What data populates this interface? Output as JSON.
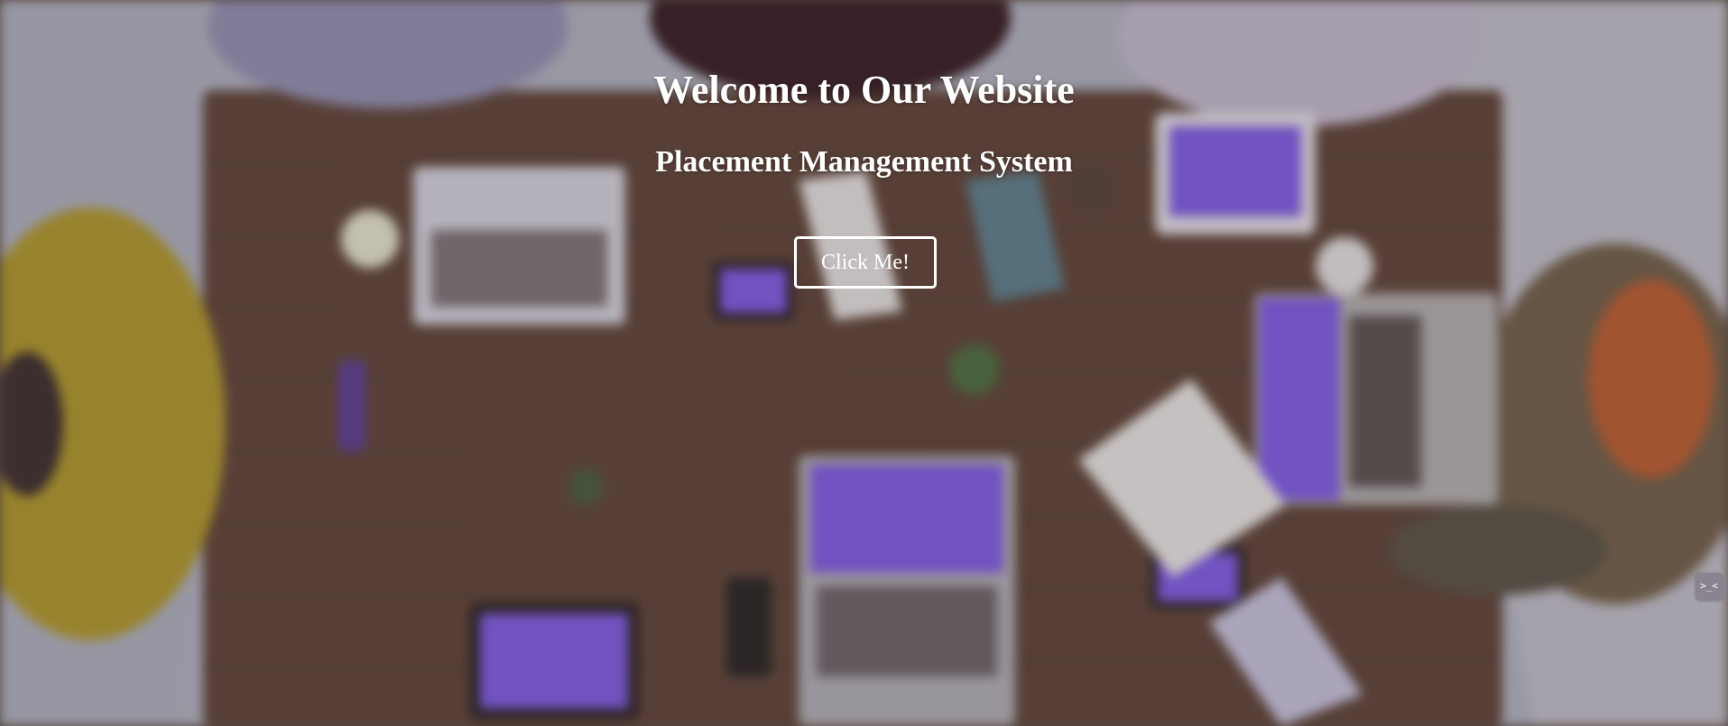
{
  "hero": {
    "title": "Welcome to Our Website",
    "subtitle": "Placement Management System",
    "button_label": "Click Me!",
    "background_image": "blurred-overhead-team-meeting-table",
    "text_color": "#ffffff",
    "accent_color": "#7b5ad6"
  },
  "side_widget": {
    "icon": "collapse-code-icon",
    "glyph": ">_<"
  }
}
